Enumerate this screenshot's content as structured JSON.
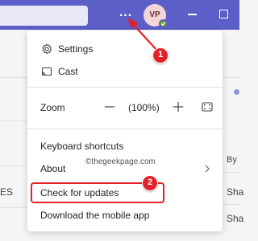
{
  "titlebar": {
    "avatar_initials": "VP",
    "more_label": "...",
    "accent_color": "#5b5fc7",
    "presence_color": "#6bb700"
  },
  "menu": {
    "settings_label": "Settings",
    "cast_label": "Cast",
    "zoom_label": "Zoom",
    "zoom_value": "(100%)",
    "keyboard_shortcuts_label": "Keyboard shortcuts",
    "about_label": "About",
    "check_updates_label": "Check for updates",
    "download_mobile_label": "Download the mobile app"
  },
  "icons": [
    "gear-icon",
    "cast-icon",
    "zoom-out-icon",
    "zoom-in-icon",
    "fullscreen-icon",
    "chevron-right-icon",
    "minimize-icon",
    "maximize-icon",
    "more-options-icon"
  ],
  "background": {
    "es_text": "ES",
    "by_text": "By",
    "sha_text": "Sha"
  },
  "annotations": {
    "step1": "1",
    "step2": "2",
    "watermark": "©thegeekpage.com",
    "highlight_color": "#e5202a"
  }
}
